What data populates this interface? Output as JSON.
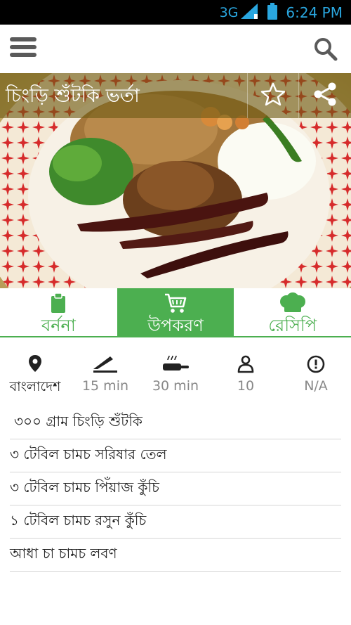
{
  "status_bar": {
    "network": "3G",
    "time": "6:24 PM",
    "icons": [
      "signal-icon",
      "battery-icon"
    ]
  },
  "app_bar": {
    "icons": [
      "menu-icon",
      "search-icon"
    ]
  },
  "recipe": {
    "title": "চিংড়ি শুঁটকি ভর্তা",
    "icons": [
      "star-outline-icon",
      "share-icon"
    ]
  },
  "tabs": [
    {
      "label": "বর্ননা",
      "icon": "clipboard-icon",
      "active": false
    },
    {
      "label": "উপকরণ",
      "icon": "cart-icon",
      "active": true
    },
    {
      "label": "রেসিপি",
      "icon": "chef-hat-icon",
      "active": false
    }
  ],
  "info": [
    {
      "icon": "location-icon",
      "value": "বাংলাদেশ"
    },
    {
      "icon": "knife-icon",
      "value": "15 min"
    },
    {
      "icon": "frying-pan-icon",
      "value": "30 min"
    },
    {
      "icon": "person-icon",
      "value": "10"
    },
    {
      "icon": "alert-icon",
      "value": "N/A"
    }
  ],
  "ingredients": [
    "৩০০ গ্রাম  চিংড়ি শুঁটকি",
    "৩ টেবিল চামচ  সরিষার তেল",
    "৩ টেবিল চামচ  পিঁয়াজ কুঁচি",
    "১ টেবিল চামচ  রসুন কুঁচি",
    "আধা চা চামচ  লবণ"
  ],
  "colors": {
    "accent": "#4caf50",
    "status_text": "#2aa7e0",
    "title_overlay": "#6e5a14"
  }
}
